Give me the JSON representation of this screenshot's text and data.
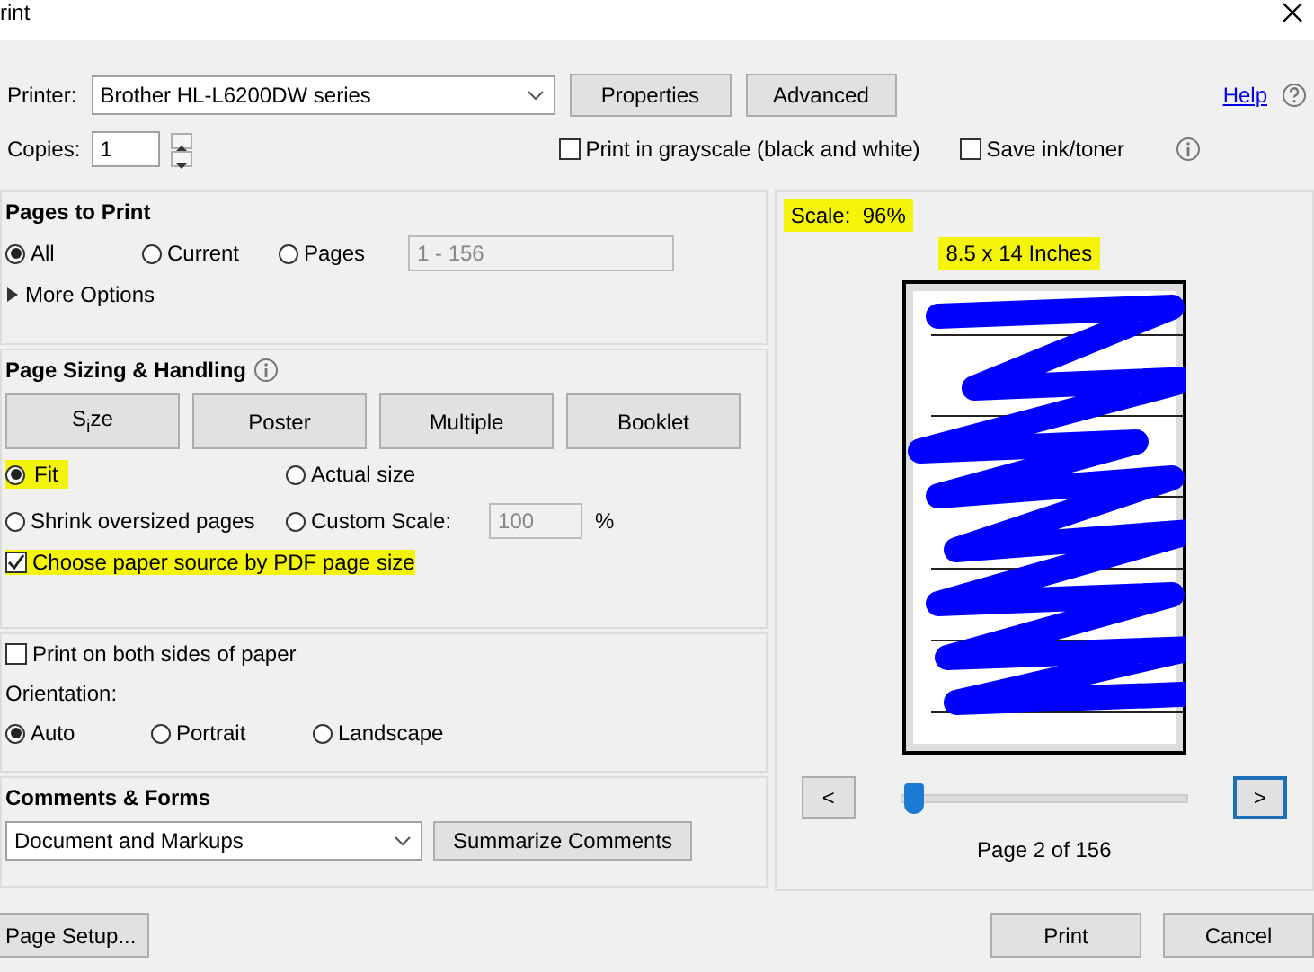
{
  "window": {
    "title": "rint"
  },
  "printer": {
    "label": "Printer:",
    "value": "Brother HL-L6200DW series",
    "buttons": [
      "Properties",
      "Advanced"
    ],
    "help": "Help"
  },
  "copies": {
    "label": "Copies:",
    "value": "1"
  },
  "options": [
    {
      "label": "Print in grayscale (black and white)",
      "checked": false
    },
    {
      "label": "Save ink/toner",
      "checked": false
    }
  ],
  "pages_to_print": {
    "title": "Pages to Print",
    "radios": [
      {
        "label": "All",
        "selected": true
      },
      {
        "label": "Current",
        "selected": false
      },
      {
        "label": "Pages",
        "selected": false
      }
    ],
    "range": "1 - 156",
    "more": "More Options"
  },
  "sizing": {
    "title": "Page Sizing & Handling",
    "tabs": [
      "S$_{i}$ze",
      "Poster",
      "Multiple",
      "Booklet"
    ],
    "radios": [
      {
        "label": "Fit",
        "selected": true,
        "highlighted": true
      },
      {
        "label": "Actual size",
        "selected": false,
        "highlighted": false
      },
      {
        "label": "Shrink oversized pages",
        "selected": false,
        "highlighted": false
      },
      {
        "label": "Custom Scale:",
        "selected": false,
        "highlighted": false
      }
    ],
    "scale": "100",
    "percent": "%",
    "paper_source": {
      "label": "Choose paper source by PDF page size",
      "checked": true,
      "highlighted": true
    }
  },
  "duplex": {
    "label": "Print on both sides of paper",
    "checked": false
  },
  "orientation": {
    "label": "Orientation:",
    "radios": [
      {
        "label": "Auto",
        "selected": true
      },
      {
        "label": "Portrait",
        "selected": false
      },
      {
        "label": "Landscape",
        "selected": false
      }
    ]
  },
  "comments": {
    "title": "Comments & Forms",
    "value": "Document and Markups",
    "button": "Summarize Comments"
  },
  "preview": {
    "scale": "Scale:  96%",
    "scale_highlighted": true,
    "paper": "8.5 x 14 Inches",
    "paper_highlighted": true,
    "prev": "<",
    "next": ">",
    "slider": {
      "level": 0.01
    },
    "page": "Page 2 of 156"
  },
  "footer": {
    "setup": "Page Setup...",
    "buttons": [
      "Print",
      "Cancel"
    ]
  }
}
